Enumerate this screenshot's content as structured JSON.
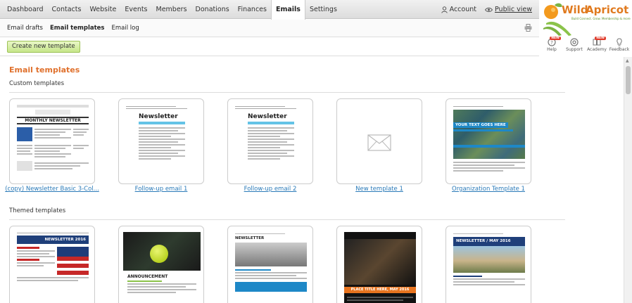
{
  "nav": {
    "items": [
      "Dashboard",
      "Contacts",
      "Website",
      "Events",
      "Members",
      "Donations",
      "Finances",
      "Emails",
      "Settings"
    ],
    "active": "Emails",
    "account_label": "Account",
    "public_view_label": "Public view"
  },
  "subnav": {
    "items": [
      "Email drafts",
      "Email templates",
      "Email log"
    ],
    "active": "Email templates"
  },
  "logo": {
    "name": "WildApricot",
    "tagline": "Build Connect. Grow. Membership & more"
  },
  "tools": [
    {
      "label": "Help",
      "badge": "NEW"
    },
    {
      "label": "Support",
      "badge": ""
    },
    {
      "label": "Academy",
      "badge": "NEW"
    },
    {
      "label": "Feedback",
      "badge": ""
    }
  ],
  "actions": {
    "create_label": "Create new template"
  },
  "page": {
    "title": "Email templates",
    "custom_section": "Custom templates",
    "themed_section": "Themed templates"
  },
  "custom_templates": [
    {
      "label": "(copy) Newsletter Basic 3-Col..."
    },
    {
      "label": "Follow-up email 1"
    },
    {
      "label": "Follow-up email 2"
    },
    {
      "label": "New template 1"
    },
    {
      "label": "Organization Template 1"
    }
  ],
  "themed_templates": [
    {
      "label": ""
    },
    {
      "label": ""
    },
    {
      "label": ""
    },
    {
      "label": ""
    },
    {
      "label": ""
    }
  ],
  "thumb_text": {
    "monthly": "MONTHLY NEWSLETTER",
    "newsletter": "Newsletter",
    "your_text": "YOUR TEXT GOES HERE",
    "newsletter_2016": "NEWSLETTER 2016",
    "announcement": "ANNOUNCEMENT",
    "newsletter_caps": "NEWSLETTER",
    "place_title": "PLACE TITLE HERE, MAY 2016",
    "wa_newsletter": "NEWSLETTER / MAY 2016"
  },
  "colors": {
    "accent": "#e0712d",
    "link": "#2a7ab8",
    "button_green": "#c6e68a",
    "new_badge": "#e03a2a"
  }
}
